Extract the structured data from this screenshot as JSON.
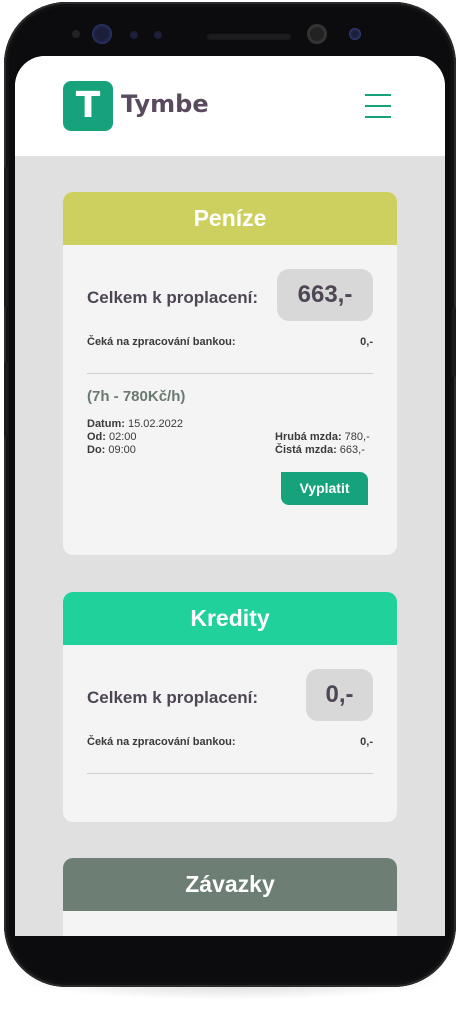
{
  "header": {
    "logo_letter": "T",
    "brand": "Tymbe"
  },
  "cards": [
    {
      "title": "Peníze",
      "color": "#cdd05e",
      "total_label": "Celkem k proplacení:",
      "total_value": "663,-",
      "pending_label": "Čeká na zpracování bankou:",
      "pending_value": "0,-",
      "shift": {
        "hours": "(7h - 780Kč/h)",
        "date_label": "Datum:",
        "date_value": " 15.02.2022",
        "from_label": "Od:",
        "from_value": " 02:00",
        "to_label": "Do:",
        "to_value": " 09:00",
        "gross_label": "Hrubá mzda:",
        "gross_value": " 780,-",
        "net_label": "Čistá mzda:",
        "net_value": " 663,-",
        "button": "Vyplatit"
      }
    },
    {
      "title": "Kredity",
      "color": "#20d19b",
      "total_label": "Celkem k proplacení:",
      "total_value": "0,-",
      "pending_label": "Čeká na zpracování bankou:",
      "pending_value": "0,-"
    },
    {
      "title": "Závazky",
      "color": "#6d7f75"
    }
  ]
}
